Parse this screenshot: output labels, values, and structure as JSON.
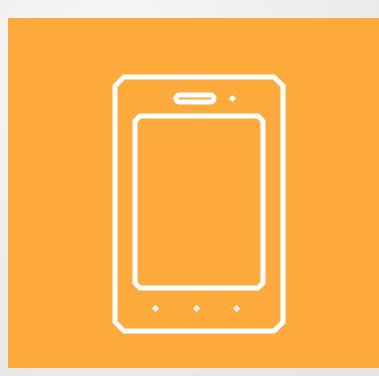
{
  "tile": {
    "background_color": "#ffaa3d",
    "icon": "tablet-icon",
    "icon_color": "#ffffff"
  }
}
